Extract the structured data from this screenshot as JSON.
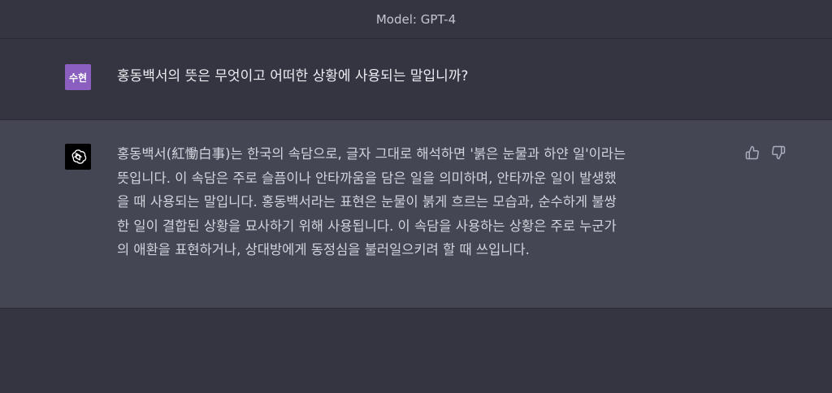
{
  "header": {
    "model_label": "Model: GPT-4"
  },
  "user_message": {
    "avatar_text": "수현",
    "text": "홍동백서의 뜻은 무엇이고 어떠한 상황에 사용되는 말입니까?",
    "avatar_color": "#8b5fbf"
  },
  "assistant_message": {
    "avatar_icon": "openai-logo-icon",
    "lines": [
      "홍동백서(紅慟白事)는 한국의 속담으로, 글자 그대로 해석하면 '붉은 눈물과 하얀 일'이라는",
      "뜻입니다. 이 속담은 주로 슬픔이나 안타까움을 담은 일을 의미하며, 안타까운 일이 발생했",
      "을 때 사용되는 말입니다. 홍동백서라는 표현은 눈물이 붉게 흐르는 모습과, 순수하게 불쌍",
      "한 일이 결합된 상황을 묘사하기 위해 사용됩니다. 이 속담을 사용하는 상황은 주로 누군가",
      "의 애환을 표현하거나, 상대방에게 동정심을 불러일으키려 할 때 쓰입니다."
    ],
    "feedback": {
      "thumbs_up_icon": "thumbs-up-icon",
      "thumbs_down_icon": "thumbs-down-icon"
    }
  },
  "colors": {
    "background": "#343541",
    "assistant_background": "#444654"
  }
}
